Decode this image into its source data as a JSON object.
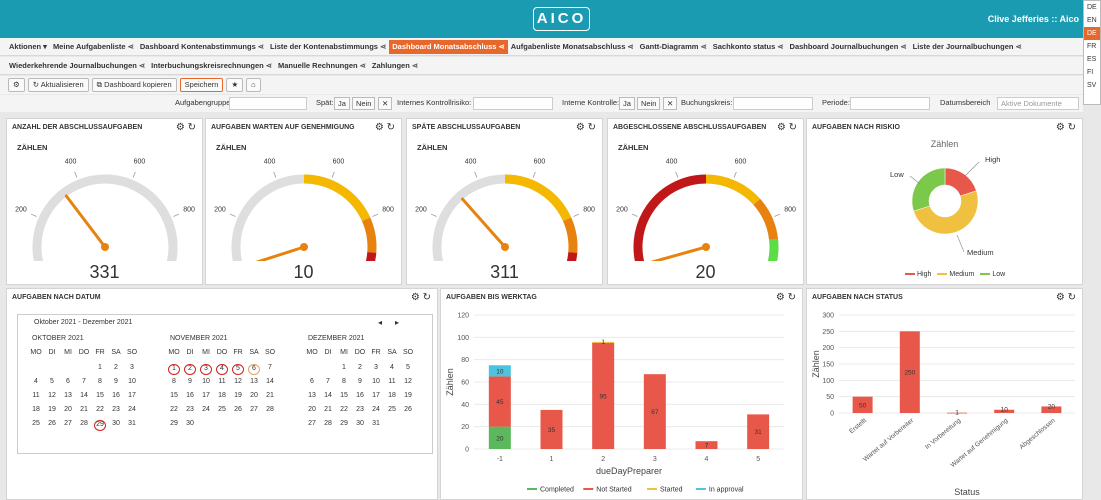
{
  "header": {
    "logo": "AICO",
    "user": "Clive Jefferies :: Aico"
  },
  "languages": [
    {
      "code": "DE",
      "selected": false
    },
    {
      "code": "EN",
      "selected": false
    },
    {
      "code": "DE",
      "selected": true
    },
    {
      "code": "FR",
      "selected": false
    },
    {
      "code": "ES",
      "selected": false
    },
    {
      "code": "FI",
      "selected": false
    },
    {
      "code": "SV",
      "selected": false
    }
  ],
  "nav_row1": [
    {
      "label": "Aktionen ▾",
      "share": false,
      "active": false
    },
    {
      "label": "Meine Aufgabenliste",
      "share": true,
      "active": false
    },
    {
      "label": "Dashboard Kontenabstimmungs",
      "share": true,
      "active": false
    },
    {
      "label": "Liste der Kontenabstimmungs",
      "share": true,
      "active": false
    },
    {
      "label": "Dashboard Monatsabschluss",
      "share": true,
      "active": true
    },
    {
      "label": "Aufgabenliste Monatsabschluss",
      "share": true,
      "active": false
    },
    {
      "label": "Gantt-Diagramm",
      "share": true,
      "active": false
    },
    {
      "label": "Sachkonto status",
      "share": true,
      "active": false
    },
    {
      "label": "Dashboard Journalbuchungen",
      "share": true,
      "active": false
    },
    {
      "label": "Liste der Journalbuchungen",
      "share": true,
      "active": false
    }
  ],
  "nav_row2": [
    {
      "label": "Wiederkehrende Journalbuchungen",
      "share": true,
      "active": false
    },
    {
      "label": "Interbuchungskreisrechnungen",
      "share": true,
      "active": false
    },
    {
      "label": "Manuelle Rechnungen",
      "share": true,
      "active": false
    },
    {
      "label": "Zahlungen",
      "share": true,
      "active": false
    }
  ],
  "toolbar": {
    "refresh": "Aktualisieren",
    "copy": "Dashboard kopieren",
    "save": "Speichern"
  },
  "filters": {
    "group_label": "Aufgabengruppe:",
    "late_label": "Spät:",
    "yes": "Ja",
    "no": "Nein",
    "ikr_label": "Internes Kontrollrisiko:",
    "ik_label": "Interne Kontrolle:",
    "bk_label": "Buchungskreis:",
    "period_label": "Periode:",
    "range_label": "Datumsbereich",
    "range_value": "Aktive Dokumente"
  },
  "gauges": [
    {
      "title": "ANZAHL DER ABSCHLUSSAUFGABEN",
      "label": "ZÄHLEN",
      "value": 331,
      "display": "331"
    },
    {
      "title": "AUFGABEN WARTEN AUF GENEHMIGUNG",
      "label": "ZÄHLEN",
      "value": 10,
      "display": "10"
    },
    {
      "title": "SPÄTE ABSCHLUSSAUFGABEN",
      "label": "ZÄHLEN",
      "value": 311,
      "display": "311"
    },
    {
      "title": "ABGESCHLOSSENE ABSCHLUSSAUFGABEN",
      "label": "ZÄHLEN",
      "value": 20,
      "display": "20"
    }
  ],
  "gauge_ticks": [
    "0",
    "200",
    "400",
    "600",
    "800",
    "1000"
  ],
  "risk": {
    "title": "AUFGABEN NACH RISKIO",
    "subtitle": "Zählen",
    "labels": {
      "high": "High",
      "low": "Low",
      "medium": "Medium"
    },
    "legend": [
      "High",
      "Medium",
      "Low"
    ]
  },
  "calendar": {
    "title": "AUFGABEN NACH DATUM",
    "range": "Oktober 2021 - Dezember 2021",
    "weekdays": [
      "MO",
      "DI",
      "MI",
      "DO",
      "FR",
      "SA",
      "SO"
    ],
    "months": [
      {
        "name": "OKTOBER 2021",
        "start": 4,
        "days": 31,
        "circled": [
          29
        ],
        "orange": []
      },
      {
        "name": "NOVEMBER 2021",
        "start": 0,
        "days": 30,
        "circled": [
          1,
          2,
          3,
          4,
          5
        ],
        "orange": [
          6
        ]
      },
      {
        "name": "DEZEMBER 2021",
        "start": 2,
        "days": 31,
        "circled": [],
        "orange": []
      }
    ]
  },
  "workday": {
    "title": "AUFGABEN BIS WERKTAG",
    "ylabel": "Zählen",
    "xlabel": "dueDayPreparer",
    "legend": [
      "Completed",
      "Not Started",
      "Started",
      "In approval"
    ]
  },
  "status": {
    "title": "AUFGABEN NACH STATUS",
    "ylabel": "Zählen",
    "xlabel": "Status"
  },
  "chart_data": [
    {
      "type": "bar",
      "title": "AUFGABEN BIS WERKTAG",
      "xlabel": "dueDayPreparer",
      "ylabel": "Zählen",
      "ylim": [
        0,
        120
      ],
      "yticks": [
        0,
        20,
        40,
        60,
        80,
        100,
        120
      ],
      "categories": [
        "-1",
        "1",
        "2",
        "3",
        "4",
        "5"
      ],
      "stacked": true,
      "series": [
        {
          "name": "Completed",
          "color": "#5cb85c",
          "values": [
            20,
            0,
            0,
            0,
            0,
            0
          ]
        },
        {
          "name": "Not Started",
          "color": "#e8584a",
          "values": [
            45,
            35,
            95,
            67,
            7,
            31
          ]
        },
        {
          "name": "Started",
          "color": "#f0c040",
          "values": [
            0,
            0,
            1,
            0,
            0,
            0
          ]
        },
        {
          "name": "In approval",
          "color": "#4cc4e0",
          "values": [
            10,
            0,
            0,
            0,
            0,
            0
          ]
        }
      ],
      "legend": "bottom"
    },
    {
      "type": "bar",
      "title": "AUFGABEN NACH STATUS",
      "xlabel": "Status",
      "ylabel": "Zählen",
      "ylim": [
        0,
        300
      ],
      "yticks": [
        0,
        50,
        100,
        150,
        200,
        250,
        300
      ],
      "categories": [
        "Erstellt",
        "Wartet auf Vorbereiter",
        "In Vorbereitung",
        "Wartet auf Genehmigung",
        "Abgeschlossen"
      ],
      "values": [
        50,
        250,
        1,
        10,
        20
      ],
      "color": "#e8584a"
    },
    {
      "type": "pie",
      "title": "AUFGABEN NACH RISKIO",
      "subtitle": "Zählen",
      "categories": [
        "High",
        "Medium",
        "Low"
      ],
      "values": [
        20,
        50,
        30
      ],
      "colors": [
        "#e8584a",
        "#f0c040",
        "#7cc84a"
      ],
      "legend": "bottom"
    }
  ]
}
